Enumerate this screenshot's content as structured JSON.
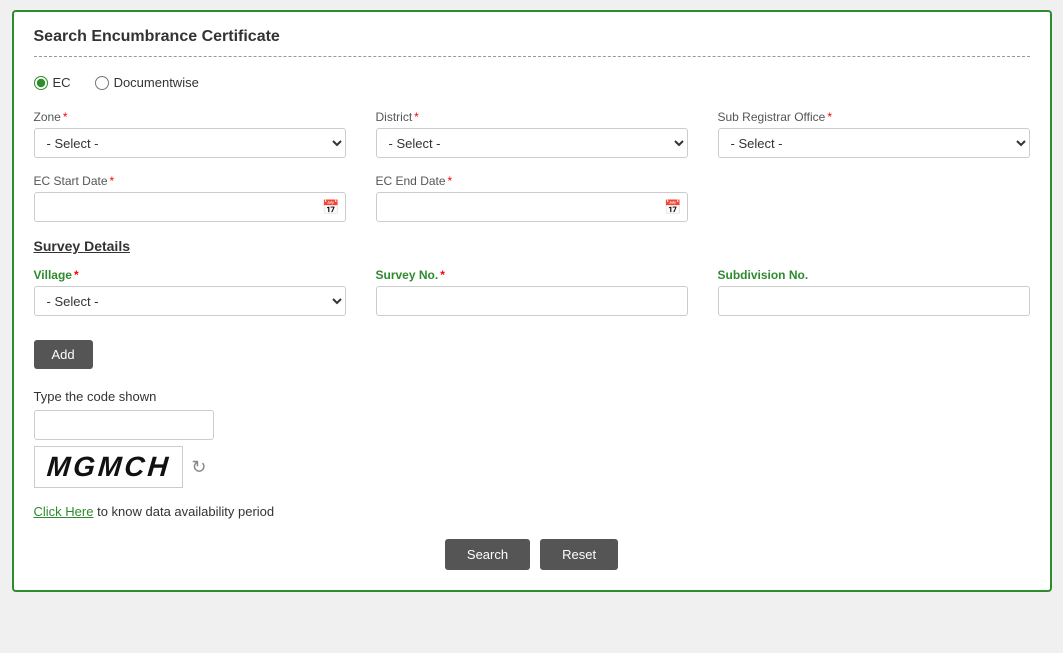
{
  "page": {
    "title": "Search Encumbrance Certificate"
  },
  "radio_options": [
    {
      "id": "ec",
      "label": "EC",
      "checked": true
    },
    {
      "id": "documentwise",
      "label": "Documentwise",
      "checked": false
    }
  ],
  "zone_field": {
    "label": "Zone",
    "required": true,
    "placeholder": "- Select -",
    "options": [
      "- Select -"
    ]
  },
  "district_field": {
    "label": "District",
    "required": true,
    "placeholder": "- Select -",
    "options": [
      "- Select -"
    ]
  },
  "sub_registrar_field": {
    "label": "Sub Registrar Office",
    "required": true,
    "placeholder": "- Select -",
    "options": [
      "- Select -"
    ]
  },
  "ec_start_date": {
    "label": "EC Start Date",
    "required": true,
    "placeholder": ""
  },
  "ec_end_date": {
    "label": "EC End Date",
    "required": true,
    "placeholder": ""
  },
  "survey_section": {
    "title": "Survey Details"
  },
  "village_field": {
    "label": "Village",
    "required": true,
    "placeholder": "- Select -",
    "options": [
      "- Select -"
    ]
  },
  "survey_no_field": {
    "label": "Survey No.",
    "required": true,
    "placeholder": ""
  },
  "subdivision_no_field": {
    "label": "Subdivision No.",
    "required": false,
    "placeholder": ""
  },
  "buttons": {
    "add": "Add",
    "search": "Search",
    "reset": "Reset"
  },
  "captcha": {
    "label": "Type the code shown",
    "value": "",
    "image_text": "MGMCH"
  },
  "click_here": {
    "link_text": "Click Here",
    "description": " to know data availability period"
  }
}
